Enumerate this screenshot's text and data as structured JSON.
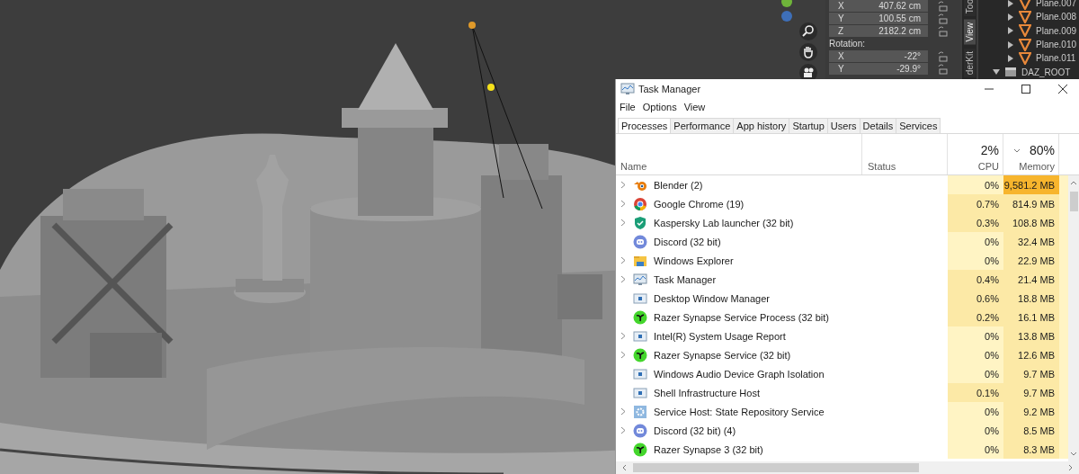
{
  "blender_panel": {
    "location": [
      {
        "axis": "X",
        "value": "407.62 cm"
      },
      {
        "axis": "Y",
        "value": "100.55 cm"
      },
      {
        "axis": "Z",
        "value": "2182.2 cm"
      }
    ],
    "rotation_label": "Rotation:",
    "rotation": [
      {
        "axis": "X",
        "value": "-22°"
      },
      {
        "axis": "Y",
        "value": "-29.9°"
      }
    ],
    "side_tabs": [
      {
        "label": "Too",
        "selected": false
      },
      {
        "label": "View",
        "selected": true
      },
      {
        "label": "derKit",
        "selected": false
      }
    ]
  },
  "outliner": {
    "items": [
      {
        "label": "Plane.007",
        "kind": "mesh",
        "expanded": false
      },
      {
        "label": "Plane.008",
        "kind": "mesh",
        "expanded": false
      },
      {
        "label": "Plane.009",
        "kind": "mesh",
        "expanded": false
      },
      {
        "label": "Plane.010",
        "kind": "mesh",
        "expanded": false
      },
      {
        "label": "Plane.011",
        "kind": "mesh",
        "expanded": false
      },
      {
        "label": "DAZ_ROOT",
        "kind": "empty",
        "expanded": true
      }
    ]
  },
  "task_manager": {
    "title": "Task Manager",
    "menu": [
      "File",
      "Options",
      "View"
    ],
    "tabs": [
      {
        "label": "Processes",
        "selected": true
      },
      {
        "label": "Performance",
        "selected": false
      },
      {
        "label": "App history",
        "selected": false
      },
      {
        "label": "Startup",
        "selected": false
      },
      {
        "label": "Users",
        "selected": false
      },
      {
        "label": "Details",
        "selected": false
      },
      {
        "label": "Services",
        "selected": false
      }
    ],
    "columns": {
      "name": "Name",
      "status": "Status",
      "cpu": {
        "total": "2%",
        "label": "CPU",
        "sorted": false
      },
      "memory": {
        "total": "80%",
        "label": "Memory",
        "sorted": true
      }
    },
    "rows": [
      {
        "name": "Blender (2)",
        "kind": "ring",
        "expandable": true,
        "cpu": {
          "text": "0%",
          "color": "#fff4c4"
        },
        "memory": {
          "text": "9,581.2 MB",
          "color": "#f7b52d"
        }
      },
      {
        "name": "Google Chrome (19)",
        "kind": "sphere",
        "expandable": true,
        "cpu": {
          "text": "0.7%",
          "color": "#fce9a6"
        },
        "memory": {
          "text": "814.9 MB",
          "color": "#fce9a6"
        }
      },
      {
        "name": "Kaspersky Lab launcher (32 bit)",
        "kind": "shield",
        "expandable": true,
        "cpu": {
          "text": "0.3%",
          "color": "#fce9a6"
        },
        "memory": {
          "text": "108.8 MB",
          "color": "#fce9a6"
        }
      },
      {
        "name": "Discord (32 bit)",
        "kind": "chat",
        "expandable": false,
        "cpu": {
          "text": "0%",
          "color": "#fff4c4"
        },
        "memory": {
          "text": "32.4 MB",
          "color": "#fce9a6"
        }
      },
      {
        "name": "Windows Explorer",
        "kind": "folder",
        "expandable": true,
        "cpu": {
          "text": "0%",
          "color": "#fff4c4"
        },
        "memory": {
          "text": "22.9 MB",
          "color": "#fce9a6"
        }
      },
      {
        "name": "Task Manager",
        "kind": "monitor",
        "expandable": true,
        "cpu": {
          "text": "0.4%",
          "color": "#fce9a6"
        },
        "memory": {
          "text": "21.4 MB",
          "color": "#fce9a6"
        }
      },
      {
        "name": "Desktop Window Manager",
        "kind": "window",
        "expandable": false,
        "cpu": {
          "text": "0.6%",
          "color": "#fce9a6"
        },
        "memory": {
          "text": "18.8 MB",
          "color": "#fce9a6"
        }
      },
      {
        "name": "Razer Synapse Service Process (32 bit)",
        "kind": "claw",
        "expandable": false,
        "cpu": {
          "text": "0.2%",
          "color": "#fce9a6"
        },
        "memory": {
          "text": "16.1 MB",
          "color": "#fce9a6"
        }
      },
      {
        "name": "Intel(R) System Usage Report",
        "kind": "window",
        "expandable": true,
        "cpu": {
          "text": "0%",
          "color": "#fff4c4"
        },
        "memory": {
          "text": "13.8 MB",
          "color": "#fce9a6"
        }
      },
      {
        "name": "Razer Synapse Service (32 bit)",
        "kind": "claw",
        "expandable": true,
        "cpu": {
          "text": "0%",
          "color": "#fff4c4"
        },
        "memory": {
          "text": "12.6 MB",
          "color": "#fce9a6"
        }
      },
      {
        "name": "Windows Audio Device Graph Isolation",
        "kind": "window",
        "expandable": false,
        "cpu": {
          "text": "0%",
          "color": "#fff4c4"
        },
        "memory": {
          "text": "9.7 MB",
          "color": "#fce9a6"
        }
      },
      {
        "name": "Shell Infrastructure Host",
        "kind": "window",
        "expandable": false,
        "cpu": {
          "text": "0.1%",
          "color": "#fce9a6"
        },
        "memory": {
          "text": "9.7 MB",
          "color": "#fce9a6"
        }
      },
      {
        "name": "Service Host: State Repository Service",
        "kind": "gear",
        "expandable": true,
        "cpu": {
          "text": "0%",
          "color": "#fff4c4"
        },
        "memory": {
          "text": "9.2 MB",
          "color": "#fce9a6"
        }
      },
      {
        "name": "Discord (32 bit) (4)",
        "kind": "chat",
        "expandable": true,
        "cpu": {
          "text": "0%",
          "color": "#fff4c4"
        },
        "memory": {
          "text": "8.5 MB",
          "color": "#fce9a6"
        }
      },
      {
        "name": "Razer Synapse 3 (32 bit)",
        "kind": "claw",
        "expandable": false,
        "cpu": {
          "text": "0%",
          "color": "#fff4c4"
        },
        "memory": {
          "text": "8.3 MB",
          "color": "#fce9a6"
        }
      }
    ]
  }
}
